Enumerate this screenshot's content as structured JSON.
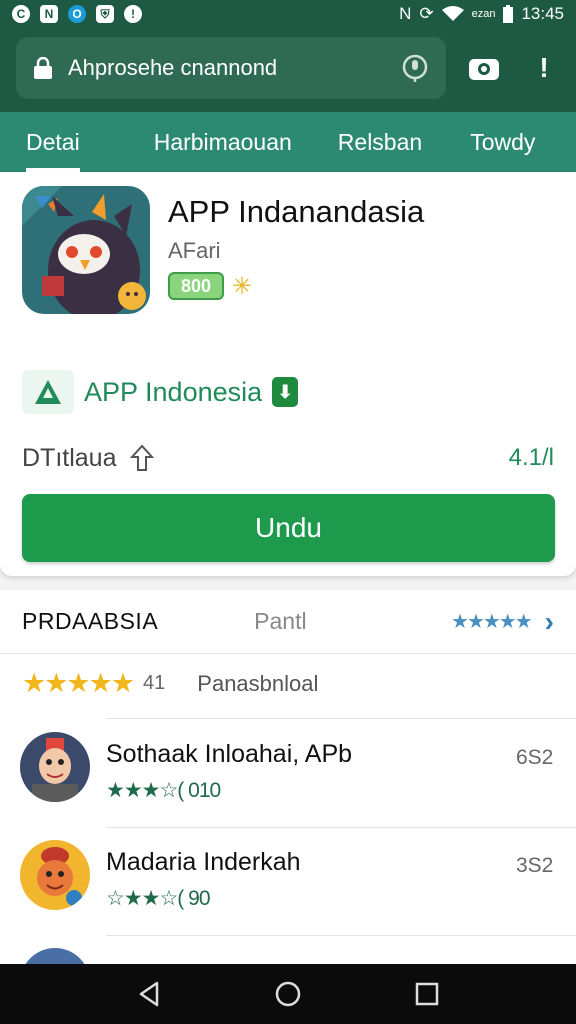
{
  "status_bar": {
    "time": "13:45",
    "data_label": "ezan",
    "left_icons": [
      "c-icon",
      "n-icon",
      "o-icon",
      "shield-icon",
      "alert-icon"
    ]
  },
  "header": {
    "url_text": "Ahprosehe cnannond",
    "mic_icon": "mic-icon",
    "camera_icon": "camera-icon",
    "more_icon": "more-vert-icon"
  },
  "tabs": [
    {
      "label": "Detai",
      "active": true
    },
    {
      "label": "Harbimaouan",
      "active": false
    },
    {
      "label": "Relsban",
      "active": false
    },
    {
      "label": "Towdy",
      "active": false
    }
  ],
  "app": {
    "title": "APP Indanandasia",
    "subtitle": "AFari",
    "age_rating": "800",
    "developer": "APP Indonesia",
    "developer_badge": "⬇",
    "info_label": "DTıtlaua",
    "size": "4.1/l",
    "install_label": "Undu"
  },
  "reviews": {
    "title": "PRDAABSIA",
    "filter_label": "Pantl",
    "header_stars": "★★★★★",
    "summary_stars": "★★★★★",
    "summary_rating": 4.5,
    "summary_count": "41",
    "summary_label": "Panasbnloal",
    "items": [
      {
        "name": "Sothaak Inloahai, APb",
        "stars": "★★★☆(",
        "count": "010",
        "score": "6S2",
        "rating": 3.5
      },
      {
        "name": "Madaria Inderkah",
        "stars": "☆★★☆(",
        "count": "90",
        "score": "3S2",
        "rating": 2.5
      }
    ]
  },
  "navbar": {
    "back_icon": "back-icon",
    "home_icon": "home-icon",
    "recents_icon": "recents-icon"
  },
  "colors": {
    "header": "#1e5a43",
    "tabs": "#2c8a73",
    "install": "#1e9a4d",
    "accent_green": "#1f8a5a",
    "star_gold": "#f2b51b"
  }
}
